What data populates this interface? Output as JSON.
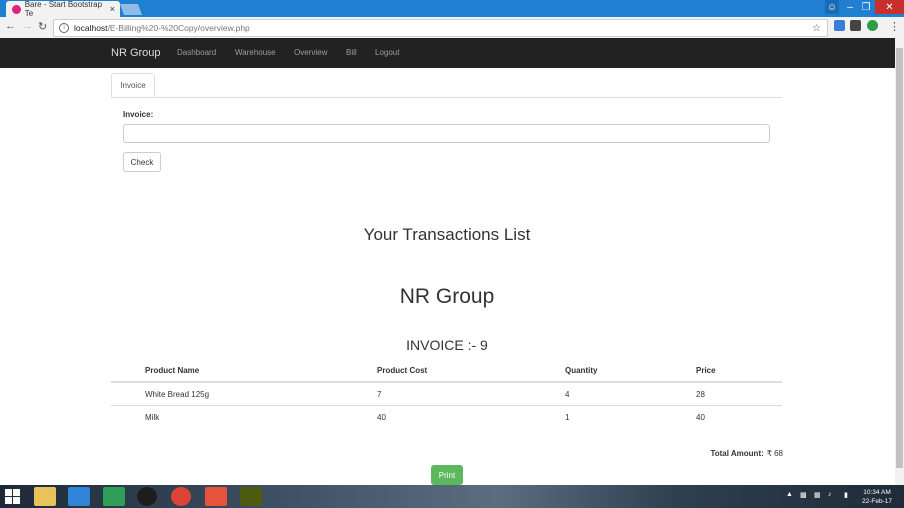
{
  "browser": {
    "tab_title": "Bare - Start Bootstrap Te",
    "tab_close": "×",
    "url_host": "localhost",
    "url_path": "/E-Billing%20-%20Copy/overview.php"
  },
  "navbar": {
    "brand": "NR Group",
    "links": [
      "Dashboard",
      "Warehouse",
      "Overview",
      "Bill",
      "Logout"
    ]
  },
  "form": {
    "tab_label": "Invoice",
    "field_label": "Invoice:",
    "field_value": "",
    "check_button": "Check"
  },
  "report": {
    "heading": "Your Transactions List",
    "company": "NR Group",
    "invoice_title": "INVOICE :- 9",
    "columns": [
      "Product Name",
      "Product Cost",
      "Quantity",
      "Price"
    ],
    "rows": [
      [
        "White Bread 125g",
        "7",
        "4",
        "28"
      ],
      [
        "Milk",
        "40",
        "1",
        "40"
      ]
    ],
    "total_label": "Total Amount:",
    "total_value": "₹  68",
    "print_button": "Print"
  },
  "taskbar": {
    "time": "10:34 AM",
    "date": "22-Feb-17"
  },
  "colors": {
    "navbar_bg": "#222222",
    "print_button": "#5cb85c",
    "tabbar": "#1f7fd1"
  }
}
